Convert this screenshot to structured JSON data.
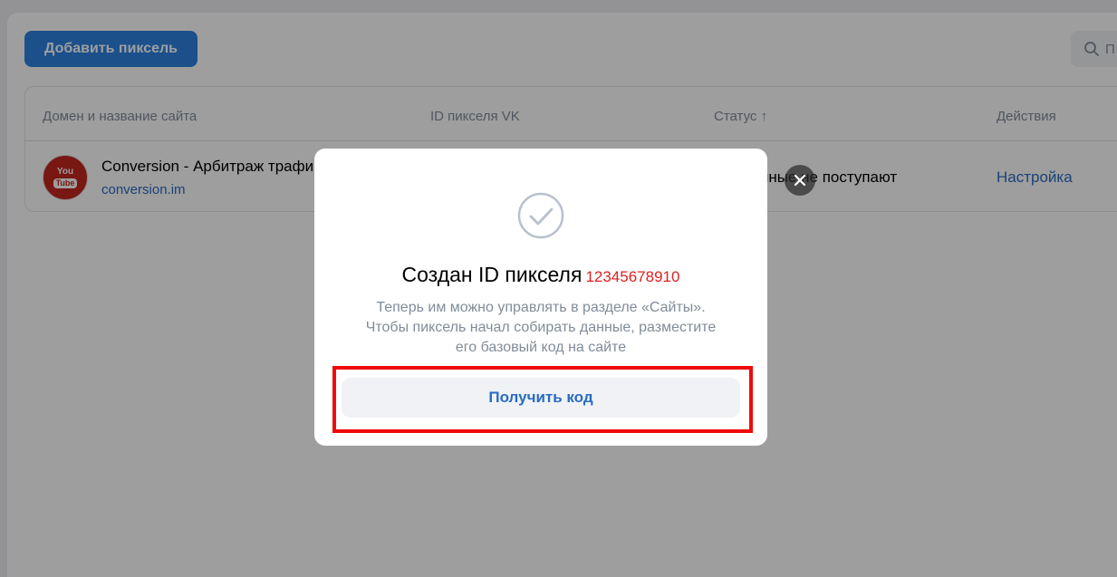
{
  "toolbar": {
    "add_pixel_label": "Добавить пиксель",
    "search_placeholder": "П"
  },
  "table": {
    "headers": [
      "Домен и название сайта",
      "ID пикселя VK",
      "Статус ↑",
      "Действия"
    ],
    "rows": [
      {
        "icon_text_top": "You",
        "icon_text_bottom": "Tube",
        "name": "Conversion - Арбитраж трафика",
        "domain": "conversion.im",
        "status": "Данные не поступают",
        "action": "Настройка"
      }
    ]
  },
  "modal": {
    "title": "Создан ID пикселя",
    "pixel_id": "12345678910",
    "description": [
      "Теперь им можно управлять в разделе «Сайты».",
      "Чтобы пиксель начал собирать данные, разместите",
      "его базовый код на сайте"
    ],
    "get_code_label": "Получить код"
  },
  "colors": {
    "accent": "#2d81e0",
    "link": "#2a6bc2",
    "highlight": "#f00a0a",
    "pixel_id": "#e01f1f"
  }
}
